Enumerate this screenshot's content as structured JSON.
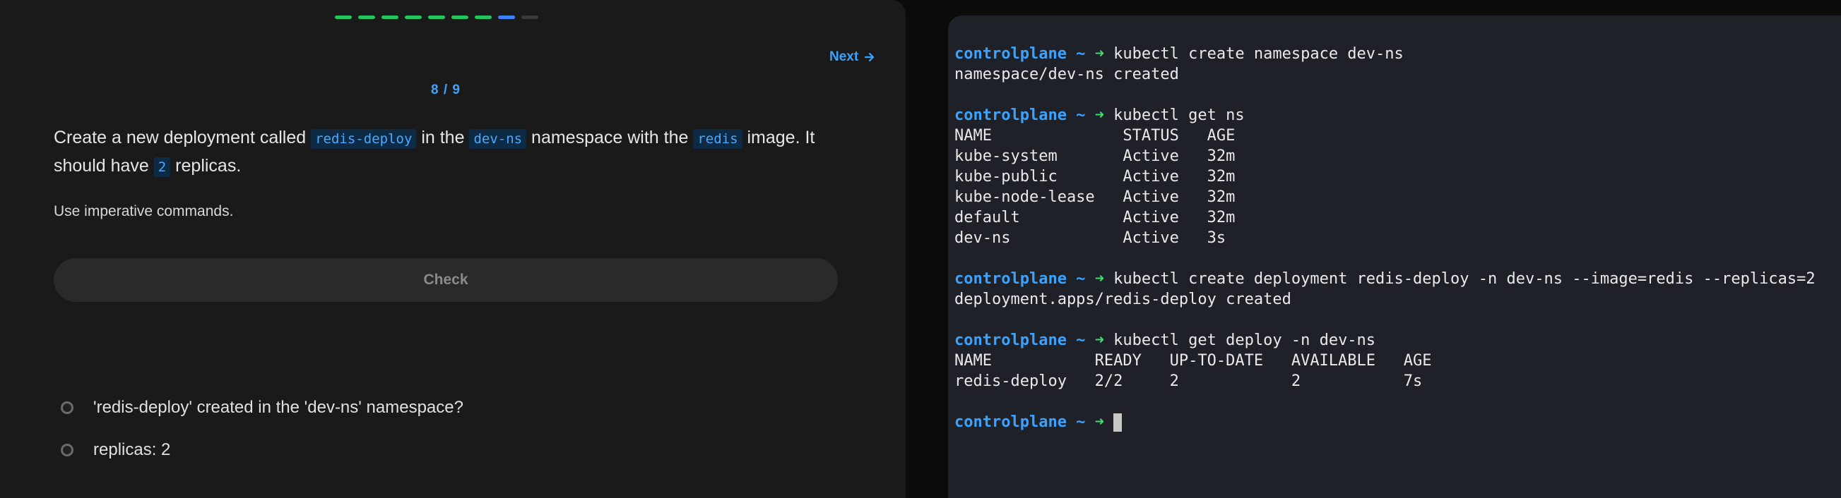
{
  "lesson": {
    "progress": {
      "total": 9,
      "current": 8,
      "colors": {
        "done": "#22c55e",
        "current": "#3b82f6",
        "todo": "#3a3a3a"
      }
    },
    "next_label": "Next",
    "counter": "8 / 9",
    "question": {
      "t1": "Create a new deployment called ",
      "c1": "redis-deploy",
      "t2": " in the ",
      "c2": "dev-ns",
      "t3": " namespace with the ",
      "c3": "redis",
      "t4": " image. It should have ",
      "c4": "2",
      "t5": " replicas."
    },
    "hint": "Use imperative commands.",
    "check_label": "Check",
    "tasks": [
      {
        "label": "'redis-deploy' created in the 'dev-ns' namespace?"
      },
      {
        "label": "replicas: 2"
      }
    ]
  },
  "terminal": {
    "prompt_host": "controlplane",
    "prompt_dir": "~",
    "prompt_arrow": "➜",
    "lines": [
      {
        "type": "prompt",
        "cmd": "kubectl create namespace dev-ns"
      },
      {
        "type": "out",
        "text": "namespace/dev-ns created"
      },
      {
        "type": "blank"
      },
      {
        "type": "prompt",
        "cmd": "kubectl get ns"
      },
      {
        "type": "out",
        "text": "NAME              STATUS   AGE"
      },
      {
        "type": "out",
        "text": "kube-system       Active   32m"
      },
      {
        "type": "out",
        "text": "kube-public       Active   32m"
      },
      {
        "type": "out",
        "text": "kube-node-lease   Active   32m"
      },
      {
        "type": "out",
        "text": "default           Active   32m"
      },
      {
        "type": "out",
        "text": "dev-ns            Active   3s"
      },
      {
        "type": "blank"
      },
      {
        "type": "prompt",
        "cmd": "kubectl create deployment redis-deploy -n dev-ns --image=redis --replicas=2"
      },
      {
        "type": "out",
        "text": "deployment.apps/redis-deploy created"
      },
      {
        "type": "blank"
      },
      {
        "type": "prompt",
        "cmd": "kubectl get deploy -n dev-ns"
      },
      {
        "type": "out",
        "text": "NAME           READY   UP-TO-DATE   AVAILABLE   AGE"
      },
      {
        "type": "out",
        "text": "redis-deploy   2/2     2            2           7s"
      },
      {
        "type": "blank"
      },
      {
        "type": "prompt",
        "cmd": "",
        "cursor": true
      }
    ]
  }
}
